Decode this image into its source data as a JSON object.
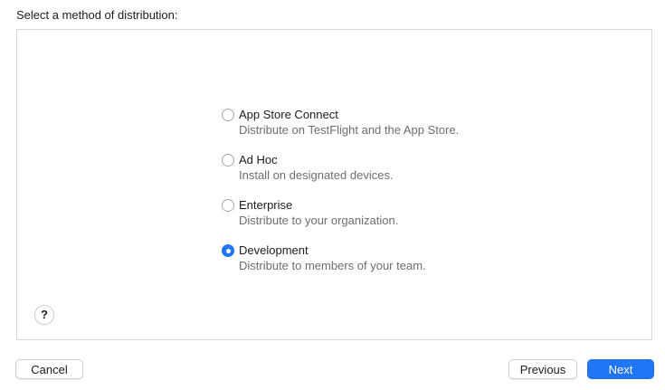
{
  "heading": "Select a method of distribution:",
  "options": [
    {
      "title": "App Store Connect",
      "description": "Distribute on TestFlight and the App Store.",
      "selected": false
    },
    {
      "title": "Ad Hoc",
      "description": "Install on designated devices.",
      "selected": false
    },
    {
      "title": "Enterprise",
      "description": "Distribute to your organization.",
      "selected": false
    },
    {
      "title": "Development",
      "description": "Distribute to members of your team.",
      "selected": true
    }
  ],
  "help": {
    "label": "?"
  },
  "buttons": {
    "cancel": "Cancel",
    "previous": "Previous",
    "next": "Next"
  },
  "colors": {
    "accent": "#2176f5",
    "secondary_text": "#6e6e73"
  }
}
